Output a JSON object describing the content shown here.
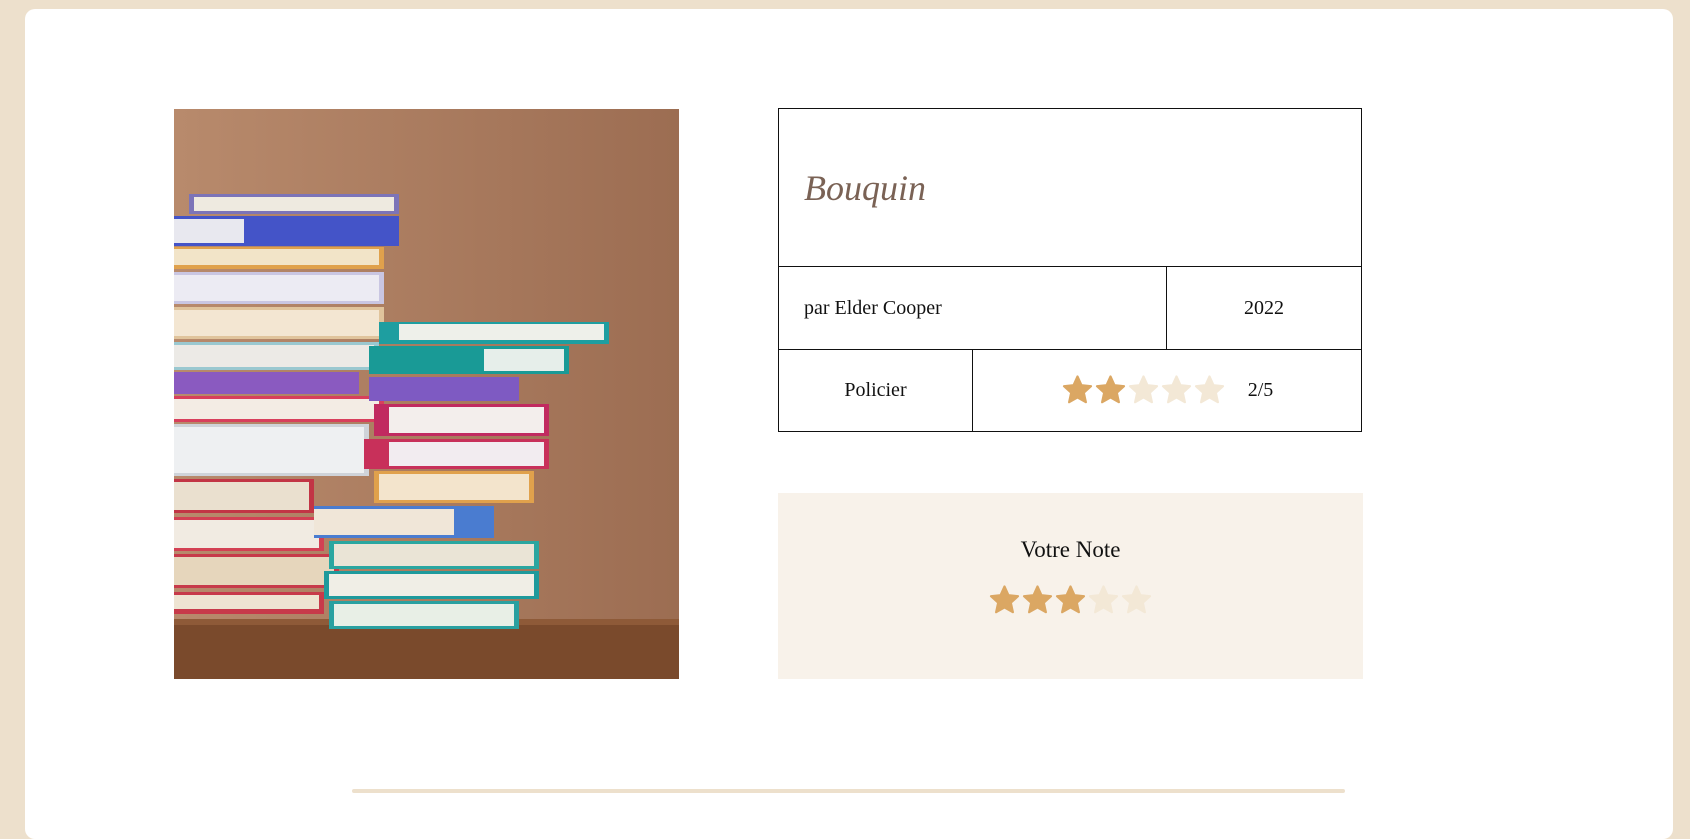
{
  "book": {
    "title": "Bouquin",
    "author": "par Elder Cooper",
    "year": "2022",
    "genre": "Policier",
    "rating": 2,
    "rating_max": 5,
    "rating_text": "2/5"
  },
  "user_rating": {
    "heading": "Votre Note",
    "value": 3,
    "max": 5
  },
  "colors": {
    "background": "#ede0cc",
    "card": "#ffffff",
    "title_text": "#7a6255",
    "star_filled": "#dba763",
    "star_empty": "#f3e8d6",
    "panel": "#f8f2ea"
  },
  "icons": {
    "star": "star-icon",
    "cover": "book-cover-image"
  }
}
